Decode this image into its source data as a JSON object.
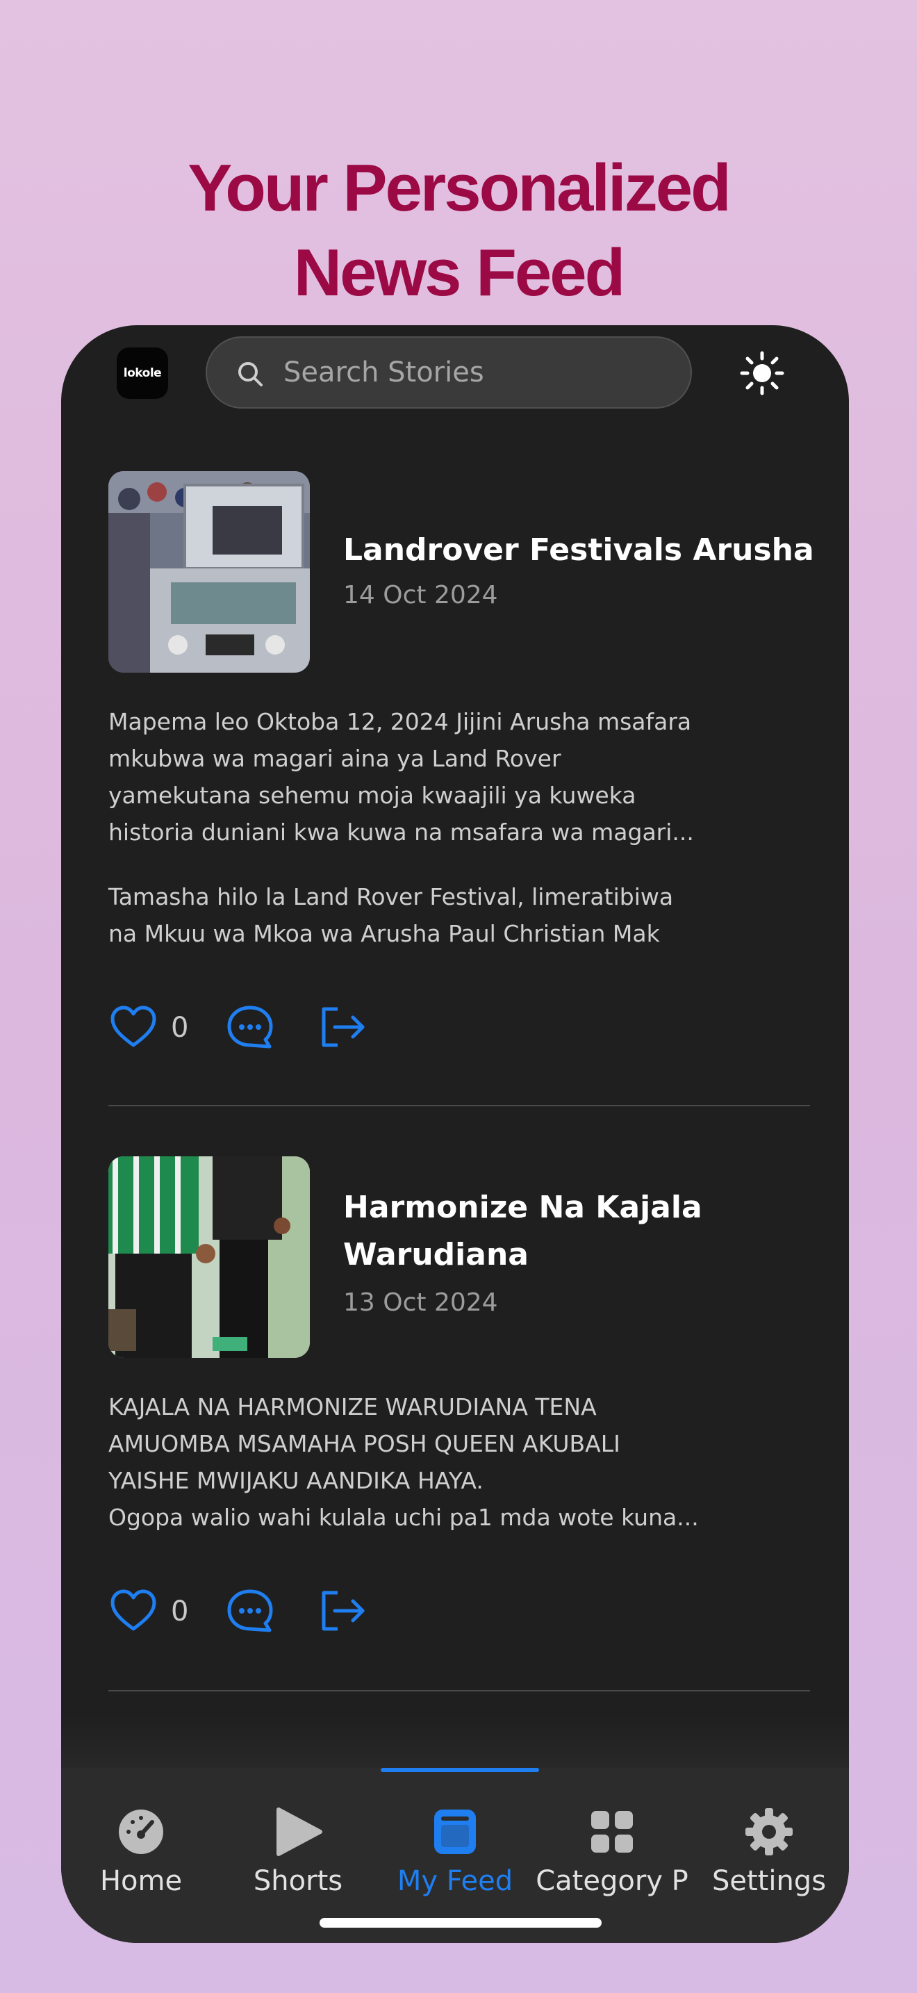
{
  "promo": {
    "headline_line1": "Your Personalized",
    "headline_line2": "News Feed"
  },
  "header": {
    "logo_text": "lokole",
    "search_placeholder": "Search Stories",
    "search_icon": "search-icon",
    "theme_icon": "sun-icon"
  },
  "feed": [
    {
      "title": "Landrover Festivals Arusha",
      "date": "14 Oct 2024",
      "excerpt1": "Mapema leo Oktoba 12, 2024 Jijini Arusha msafara\nmkubwa wa magari aina ya Land Rover\nyamekutana sehemu moja kwaajili ya kuweka\nhistoria duniani kwa kuwa na msafara wa magari...",
      "excerpt2": "Tamasha hilo la Land Rover Festival, limeratibiwa\nna Mkuu wa Mkoa wa Arusha Paul Christian Mak",
      "likes": "0"
    },
    {
      "title": "Harmonize Na Kajala Warudiana",
      "date": "13 Oct 2024",
      "excerpt1": "KAJALA NA HARMONIZE WARUDIANA TENA\nAMUOMBA MSAMAHA POSH QUEEN AKUBALI\nYAISHE MWIJAKU AANDIKA HAYA.\nOgopa walio wahi kulala uchi pa1 mda wote kuna...",
      "likes": "0"
    }
  ],
  "tabs": [
    {
      "label": "Home",
      "icon": "gauge-icon",
      "active": false
    },
    {
      "label": "Shorts",
      "icon": "play-icon",
      "active": false
    },
    {
      "label": "My Feed",
      "icon": "feed-icon",
      "active": true
    },
    {
      "label": "Category P",
      "icon": "grid-icon",
      "active": false
    },
    {
      "label": "Settings",
      "icon": "gear-icon",
      "active": false
    }
  ],
  "colors": {
    "accent": "#1f7ef0",
    "headline": "#9b0a45",
    "phone_bg": "#1f1f1f"
  }
}
